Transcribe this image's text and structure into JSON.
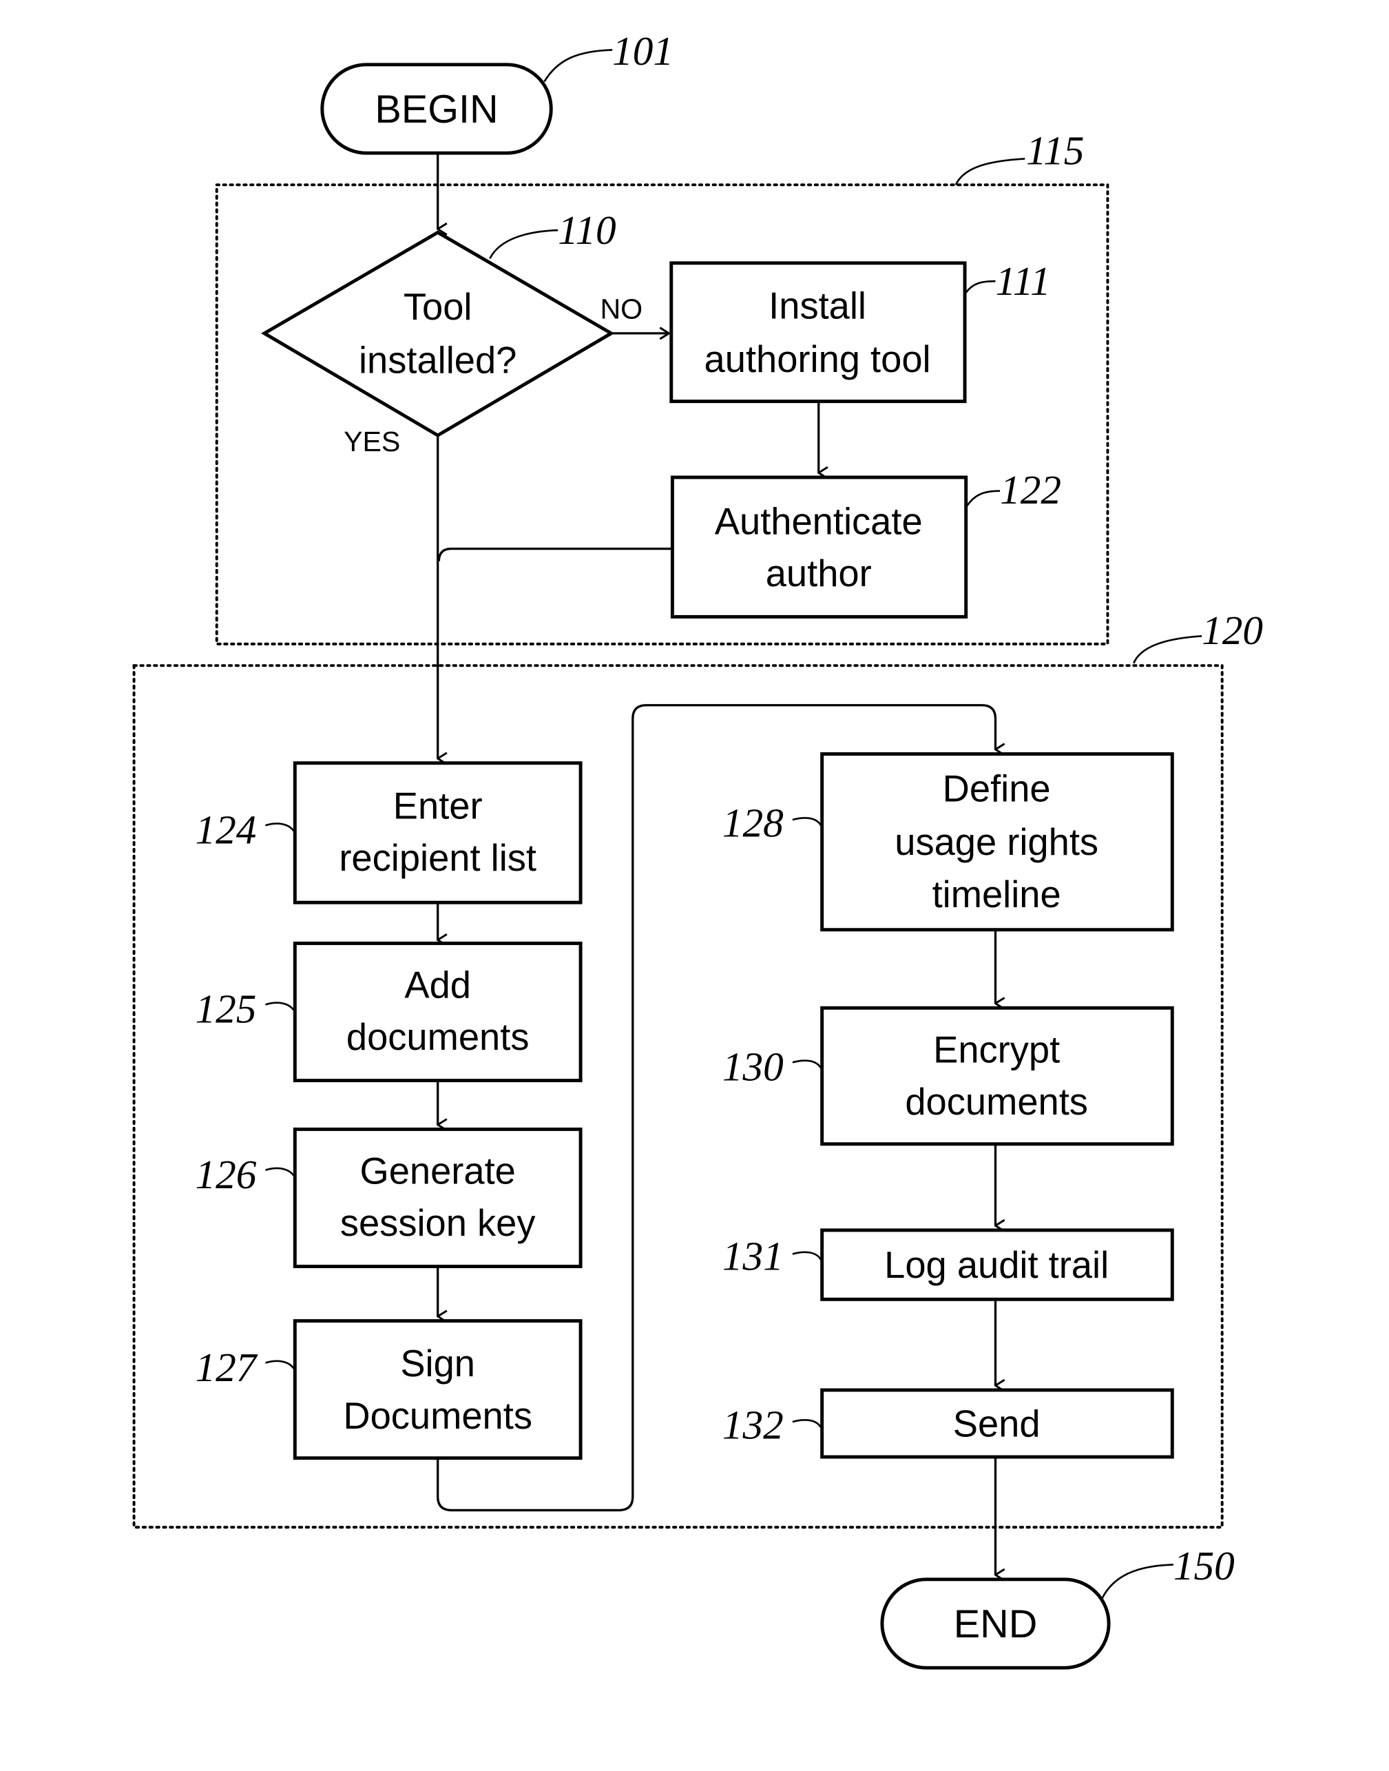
{
  "figure": {
    "terminals": {
      "begin": {
        "label": "BEGIN",
        "ref": "101"
      },
      "end": {
        "label": "END",
        "ref": "150"
      }
    },
    "groups": {
      "setup": {
        "ref": "115"
      },
      "authoring": {
        "ref": "120"
      }
    },
    "decision": {
      "lines": [
        "Tool",
        "installed?"
      ],
      "ref": "110",
      "yes_label": "YES",
      "no_label": "NO"
    },
    "steps": {
      "install": {
        "lines": [
          "Install",
          "authoring tool"
        ],
        "ref": "111"
      },
      "authenticate": {
        "lines": [
          "Authenticate",
          "author"
        ],
        "ref": "122"
      },
      "recipients": {
        "lines": [
          "Enter",
          "recipient list"
        ],
        "ref": "124"
      },
      "add_docs": {
        "lines": [
          "Add",
          "documents"
        ],
        "ref": "125"
      },
      "session_key": {
        "lines": [
          "Generate",
          "session key"
        ],
        "ref": "126"
      },
      "sign": {
        "lines": [
          "Sign",
          "Documents"
        ],
        "ref": "127"
      },
      "rights": {
        "lines": [
          "Define",
          "usage rights",
          "timeline"
        ],
        "ref": "128"
      },
      "encrypt": {
        "lines": [
          "Encrypt",
          "documents"
        ],
        "ref": "130"
      },
      "audit": {
        "lines": [
          "Log audit trail"
        ],
        "ref": "131"
      },
      "send": {
        "lines": [
          "Send"
        ],
        "ref": "132"
      }
    }
  }
}
